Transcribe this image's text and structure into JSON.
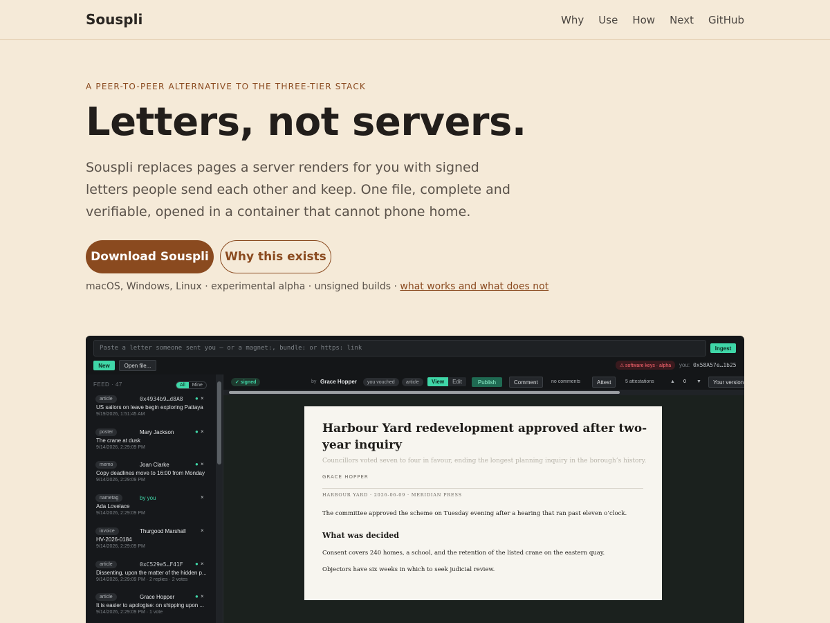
{
  "header": {
    "brand": "Souspli",
    "nav": [
      "Why",
      "Use",
      "How",
      "Next",
      "GitHub"
    ]
  },
  "hero": {
    "eyebrow": "A PEER-TO-PEER ALTERNATIVE TO THE THREE-TIER STACK",
    "headline": "Letters, not servers.",
    "lede": "Souspli replaces pages a server renders for you with signed letters people send each other and keep. One file, complete and verifiable, opened in a container that cannot phone home.",
    "primary_button": "Download Souspli",
    "secondary_button": "Why this exists",
    "platforms_text": "macOS, Windows, Linux · experimental alpha · unsigned builds · ",
    "platforms_link": "what works and what does not"
  },
  "app": {
    "input_placeholder": "Paste a letter someone sent you — or a magnet:, bundle: or https: link",
    "ingest_label": "Ingest",
    "new_label": "New",
    "open_file_label": "Open file...",
    "warning_badge": "⚠ software keys · alpha",
    "you_label": "you:",
    "you_value": "0x58A57e…1b25",
    "feed_label": "FEED · 47",
    "feed_filter_all": "All",
    "feed_filter_mine": "Mine",
    "feed": [
      {
        "type": "article",
        "author": "0x4934b9…d8A8",
        "author_mono": true,
        "title": "US sailors on leave begin exploring Pattaya",
        "date": "9/19/2026, 1:51:45 AM",
        "dot": true
      },
      {
        "type": "poster",
        "author": "Mary Jackson",
        "title": "The crane at dusk",
        "date": "9/14/2026, 2:29:09 PM",
        "dot": true
      },
      {
        "type": "memo",
        "author": "Joan Clarke",
        "title": "Copy deadlines move to 16:00 from Monday",
        "date": "9/14/2026, 2:29:09 PM",
        "dot": true
      },
      {
        "type": "nametag",
        "author": "by you",
        "mine": true,
        "title": "Ada Lovelace",
        "date": "9/14/2026, 2:29:09 PM",
        "dot": false
      },
      {
        "type": "invoice",
        "author": "Thurgood Marshall",
        "title": "HV-2026-0184",
        "date": "9/14/2026, 2:29:09 PM",
        "dot": false
      },
      {
        "type": "article",
        "author": "0xC529e5…F41F",
        "author_mono": true,
        "title": "Dissenting, upon the matter of the hidden p...",
        "date": "9/14/2026, 2:29:09 PM · 2 replies · 2 votes",
        "dot": true
      },
      {
        "type": "article",
        "author": "Grace Hopper",
        "title": "It is easier to apologise: on shipping upon ...",
        "date": "9/14/2026, 2:29:09 PM · 1 vote",
        "dot": true
      }
    ],
    "toolbar": {
      "signed": "✓ signed",
      "by": "by",
      "author": "Grace Hopper",
      "vouched": "you vouched",
      "kind": "article",
      "view": "View",
      "edit": "Edit",
      "publish": "Publish",
      "comment": "Comment",
      "no_comments": "no comments",
      "attest": "Attest",
      "attestations": "5 attestations",
      "up": "▲",
      "votes": "0",
      "down": "▼",
      "your_version": "Your version"
    },
    "letter": {
      "title": "Harbour Yard redevelopment approved after two-year inquiry",
      "subtitle": "Councillors voted seven to four in favour, ending the longest planning inquiry in the borough’s history.",
      "author": "GRACE HOPPER",
      "meta": "HARBOUR YARD · 2026-06-09 · MERIDIAN PRESS",
      "p1": "The committee approved the scheme on Tuesday evening after a hearing that ran past eleven o’clock.",
      "h2": "What was decided",
      "p2": "Consent covers 240 homes, a school, and the retention of the listed crane on the eastern quay.",
      "p3": "Objectors have six weeks in which to seek judicial review."
    }
  }
}
